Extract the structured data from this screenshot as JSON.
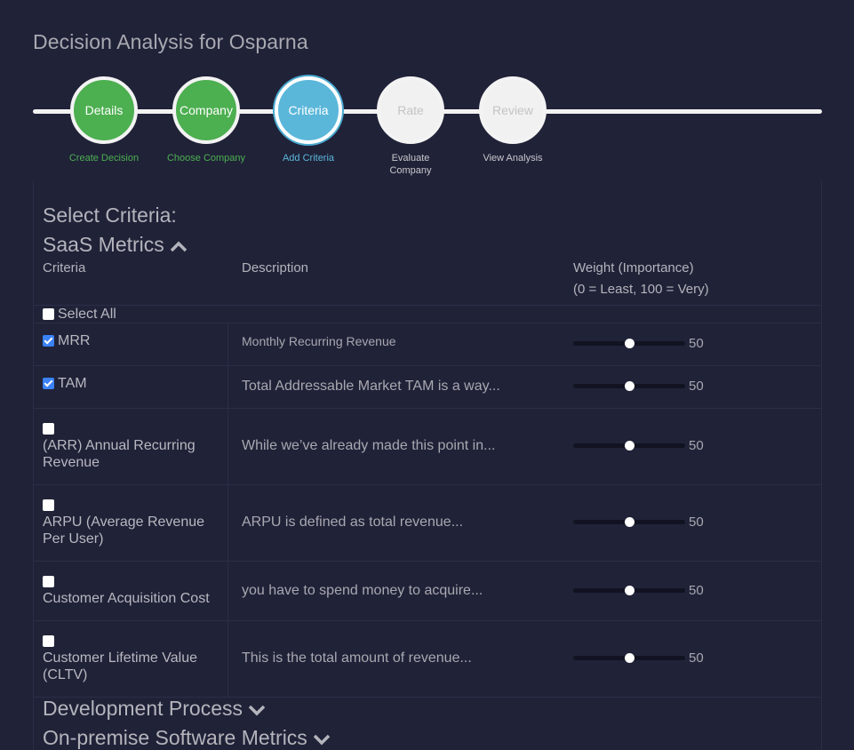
{
  "page": {
    "title": "Decision Analysis for Osparna"
  },
  "stepper": {
    "steps": [
      {
        "circle": "Details",
        "label": "Create Decision",
        "state": "done"
      },
      {
        "circle": "Company",
        "label": "Choose Company",
        "state": "done"
      },
      {
        "circle": "Criteria",
        "label": "Add Criteria",
        "state": "active"
      },
      {
        "circle": "Rate",
        "label": "Evaluate Company",
        "state": "todo"
      },
      {
        "circle": "Review",
        "label": "View Analysis",
        "state": "todo"
      }
    ]
  },
  "colors": {
    "done": "#4caf50",
    "active": "#5bb7da",
    "todo": "#f1f1f1",
    "background": "#202238",
    "checkbox_checked": "#3b82f6"
  },
  "criteria": {
    "heading": "Select Criteria:",
    "groups": [
      {
        "name": "SaaS Metrics",
        "expanded": true,
        "icon": "chevron-up-icon"
      },
      {
        "name": "Development Process",
        "expanded": false,
        "icon": "chevron-down-icon"
      },
      {
        "name": "On-premise Software Metrics",
        "expanded": false,
        "icon": "chevron-down-icon"
      }
    ],
    "table": {
      "headers": {
        "criteria": "Criteria",
        "description": "Description",
        "weight_line1": "Weight (Importance)",
        "weight_line2": "(0 = Least, 100 = Very)"
      },
      "select_all": {
        "label": "Select All",
        "checked": false
      },
      "rows": [
        {
          "name": "MRR",
          "description": "Monthly Recurring Revenue",
          "checked": true,
          "weight": 50
        },
        {
          "name": "TAM",
          "description": "Total Addressable Market TAM is a way...",
          "checked": true,
          "weight": 50
        },
        {
          "name": "(ARR) Annual Recurring Revenue",
          "description": "While we’ve already made this point in...",
          "checked": false,
          "weight": 50
        },
        {
          "name": "ARPU (Average Revenue Per User)",
          "description": "ARPU is defined as total revenue...",
          "checked": false,
          "weight": 50
        },
        {
          "name": "Customer Acquisition Cost",
          "description": "you have to spend money to acquire...",
          "checked": false,
          "weight": 50
        },
        {
          "name": "Customer Lifetime Value (CLTV)",
          "description": "This is the total amount of revenue...",
          "checked": false,
          "weight": 50
        }
      ],
      "weight_range": [
        0,
        100
      ]
    }
  }
}
